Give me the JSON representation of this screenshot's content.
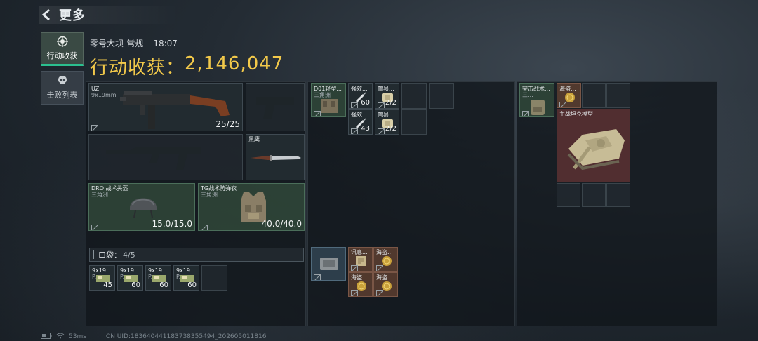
{
  "header": {
    "title": "更多",
    "back_icon": "back-chevron-icon"
  },
  "sidebar": {
    "tabs": [
      {
        "label": "行动收获",
        "icon": "target-icon",
        "active": true
      },
      {
        "label": "击败列表",
        "icon": "skull-icon",
        "active": false
      }
    ]
  },
  "match": {
    "map": "零号大坝-常规",
    "time": "18:07"
  },
  "earnings": {
    "label": "行动收获：",
    "value": "2,146,047"
  },
  "loadout": {
    "primary": {
      "name": "UZI",
      "caliber": "9x19mm",
      "ammo": "25/25"
    },
    "melee": {
      "name": "黑鹰"
    },
    "helmet": {
      "name": "DRO 战术头盔",
      "faction": "三角洲",
      "durability": "15.0/15.0"
    },
    "armor": {
      "name": "TG战术防弹衣",
      "faction": "三角洲",
      "durability": "40.0/40.0"
    }
  },
  "pockets": {
    "label": "口袋：",
    "count": "4/5",
    "items": [
      {
        "name": "9x19",
        "sub": "P...",
        "qty": "45"
      },
      {
        "name": "9x19",
        "sub": "P...",
        "qty": "60"
      },
      {
        "name": "9x19",
        "sub": "P...",
        "qty": "60"
      },
      {
        "name": "9x19",
        "sub": "P...",
        "qty": "60"
      }
    ]
  },
  "chest_rig": {
    "name": "D01轻型...",
    "sub": "三角洲",
    "items": [
      {
        "name": "强效...",
        "qty": "60"
      },
      {
        "name": "简易...",
        "qty": "2/2"
      },
      {
        "name": "强效...",
        "qty": "43"
      },
      {
        "name": "简易...",
        "qty": "2/2"
      }
    ]
  },
  "secure_case": {
    "items": [
      {
        "name": "讯息...",
        "qty": ""
      },
      {
        "name": "海盗...",
        "qty": ""
      },
      {
        "name": "海盗...",
        "qty": ""
      },
      {
        "name": "海盗...",
        "qty": ""
      }
    ]
  },
  "backpack": {
    "name": "突击战术...",
    "sub": "三...",
    "items": [
      {
        "name": "海盗...",
        "qty": ""
      },
      {
        "name": "主战坦克模型",
        "qty": ""
      }
    ]
  },
  "footer": {
    "latency": "53ms",
    "uid": "CN UID:183640441183738355494_202605011816"
  },
  "colors": {
    "accent_gold": "#f2c94a",
    "active_tab": "#2bbf8e"
  }
}
